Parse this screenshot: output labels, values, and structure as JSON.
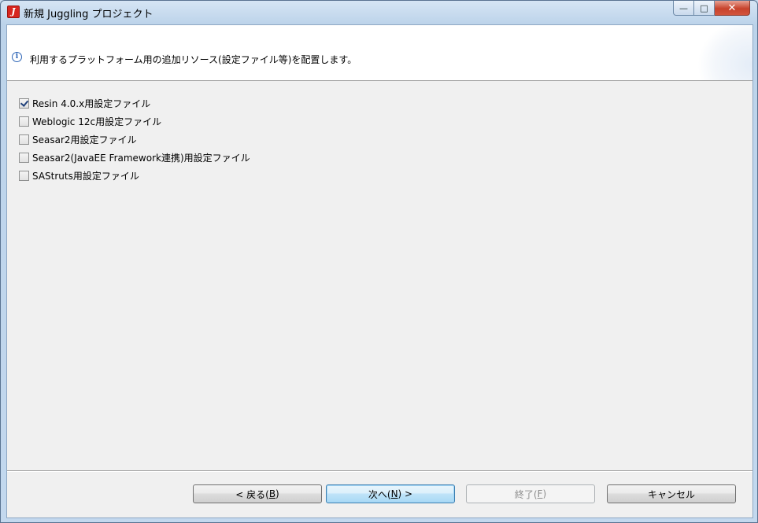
{
  "window": {
    "title": "新規 Juggling プロジェクト",
    "app_icon_letter": "J"
  },
  "window_controls": {
    "minimize": "—",
    "maximize": "□",
    "close": "✕"
  },
  "banner": {
    "message": "利用するプラットフォーム用の追加リソース(設定ファイル等)を配置します。",
    "info_glyph": "i"
  },
  "options": [
    {
      "label": "Resin 4.0.x用設定ファイル",
      "checked": true
    },
    {
      "label": "Weblogic 12c用設定ファイル",
      "checked": false
    },
    {
      "label": "Seasar2用設定ファイル",
      "checked": false
    },
    {
      "label": "Seasar2(JavaEE Framework連携)用設定ファイル",
      "checked": false
    },
    {
      "label": "SAStruts用設定ファイル",
      "checked": false
    }
  ],
  "buttons": {
    "back": {
      "pre": "< 戻る(",
      "mnemonic": "B",
      "post": ")"
    },
    "next": {
      "pre": "次へ(",
      "mnemonic": "N",
      "post": ") >"
    },
    "finish": {
      "pre": "終了(",
      "mnemonic": "F",
      "post": ")"
    },
    "cancel": {
      "label": "キャンセル"
    }
  }
}
